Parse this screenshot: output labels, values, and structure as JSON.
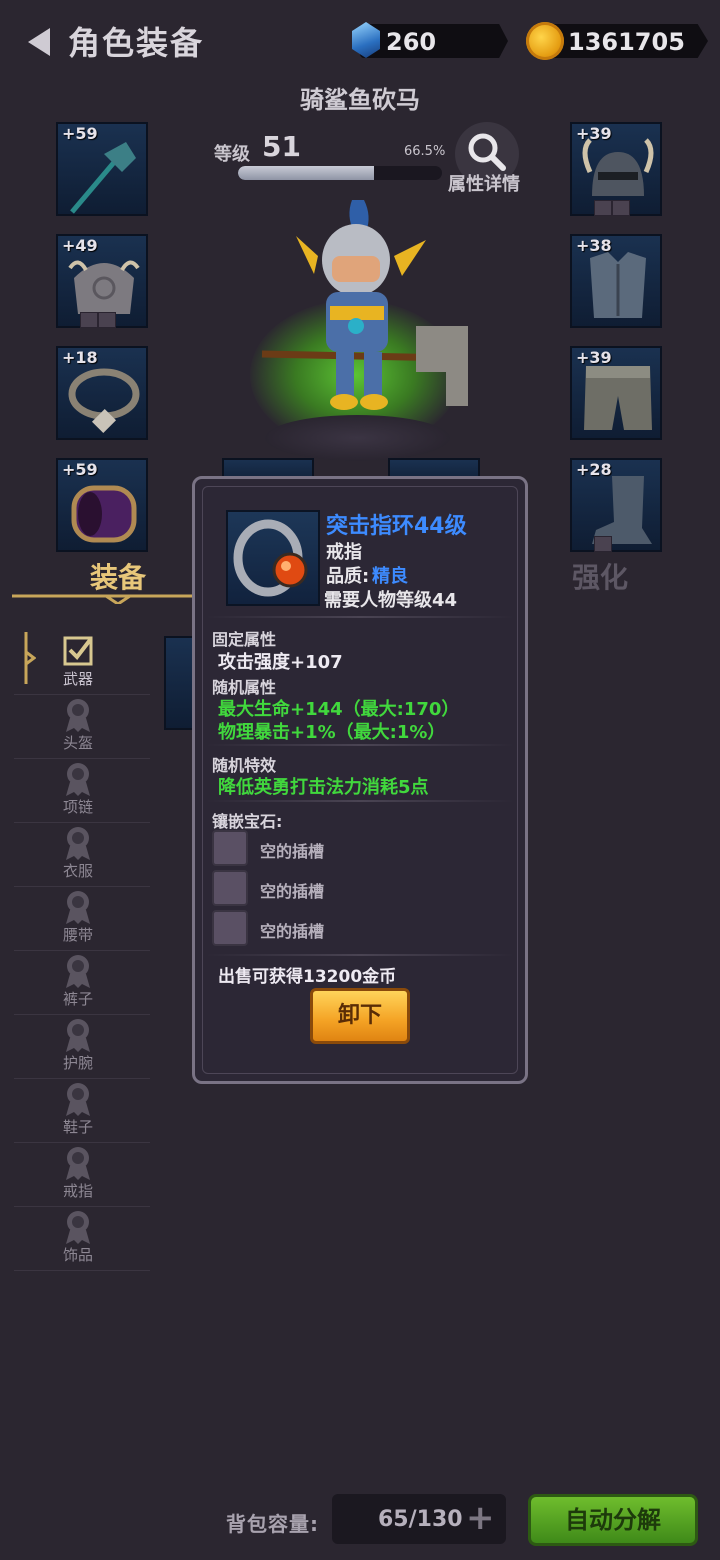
{
  "header": {
    "title": "角色装备",
    "gems": "260",
    "gold": "1361705"
  },
  "character": {
    "name": "骑鲨鱼砍马",
    "level_label": "等级",
    "level": "51",
    "exp_percent": "66.5%",
    "exp_fraction": 0.665,
    "details_label": "属性详情"
  },
  "slots": {
    "left": [
      {
        "plus": "+59",
        "icon": "axe-icon"
      },
      {
        "plus": "+49",
        "icon": "pauldron-icon"
      },
      {
        "plus": "+18",
        "icon": "necklace-icon"
      },
      {
        "plus": "+59",
        "icon": "bracer-icon"
      }
    ],
    "right": [
      {
        "plus": "+39",
        "icon": "horned-helmet-icon"
      },
      {
        "plus": "+38",
        "icon": "chest-armor-icon"
      },
      {
        "plus": "+39",
        "icon": "leg-armor-icon"
      },
      {
        "plus": "+28",
        "icon": "boot-icon"
      }
    ]
  },
  "tabs": {
    "equip": "装备",
    "enhance": "强化"
  },
  "categories": [
    "武器",
    "头盔",
    "项链",
    "衣服",
    "腰带",
    "裤子",
    "护腕",
    "鞋子",
    "戒指",
    "饰品"
  ],
  "popup": {
    "item_name": "突击指环44级",
    "item_type": "戒指",
    "quality_label": "品质:",
    "quality_value": "精良",
    "requirement": "需要人物等级44",
    "fixed_label": "固定属性",
    "fixed_attr": "攻击强度+107",
    "random_label": "随机属性",
    "random_attrs": [
      "最大生命+144（最大:170）",
      "物理暴击+1%（最大:1%）"
    ],
    "effect_label": "随机特效",
    "effect": "降低英勇打击法力消耗5点",
    "gems_label": "镶嵌宝石:",
    "sockets": [
      "空的插槽",
      "空的插槽",
      "空的插槽"
    ],
    "sell": "出售可获得13200金币",
    "unequip": "卸下"
  },
  "bag": {
    "label": "背包容量:",
    "value": "65/130",
    "plus": "+",
    "auto_decompose": "自动分解"
  },
  "colors": {
    "background": "#2b2630",
    "rare_blue": "#3d8bff",
    "green_attr": "#41d83d",
    "gold_tab": "#e8c77a",
    "button_orange": "#f4a224",
    "button_green": "#4f9e1f"
  }
}
